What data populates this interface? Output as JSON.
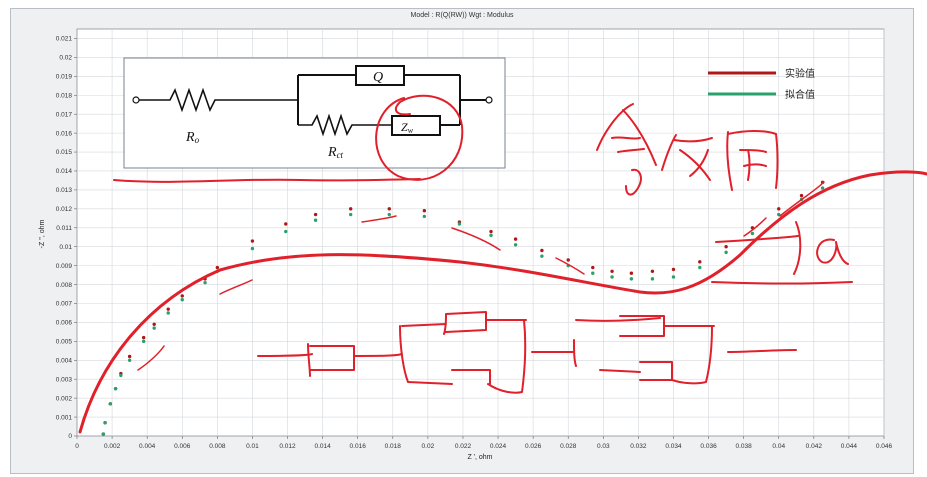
{
  "window": {
    "title": "Model : R(Q(RW))     Wgt : Modulus"
  },
  "chart_data": {
    "type": "scatter",
    "xlabel": "Z ', ohm",
    "ylabel": "-Z '', ohm",
    "xlim": [
      0,
      0.046
    ],
    "ylim": [
      0,
      0.0215
    ],
    "xticks": [
      "0",
      "0.002",
      "0.004",
      "0.006",
      "0.008",
      "0.01",
      "0.012",
      "0.014",
      "0.016",
      "0.018",
      "0.02",
      "0.022",
      "0.024",
      "0.026",
      "0.028",
      "0.03",
      "0.032",
      "0.034",
      "0.036",
      "0.038",
      "0.04",
      "0.042",
      "0.044",
      "0.046"
    ],
    "yticks": [
      "0",
      "0.001",
      "0.002",
      "0.003",
      "0.004",
      "0.005",
      "0.006",
      "0.007",
      "0.008",
      "0.009",
      "0.01",
      "0.011",
      "0.012",
      "0.013",
      "0.014",
      "0.015",
      "0.016",
      "0.017",
      "0.018",
      "0.019",
      "0.02",
      "0.021"
    ],
    "grid": true,
    "legend": "top-right",
    "series": [
      {
        "name": "实验值",
        "color": "#b01818",
        "points": [
          [
            0.0015,
            0.0001
          ],
          [
            0.0016,
            0.0007
          ],
          [
            0.0019,
            0.0017
          ],
          [
            0.0022,
            0.0025
          ],
          [
            0.0025,
            0.0033
          ],
          [
            0.003,
            0.0042
          ],
          [
            0.0038,
            0.0052
          ],
          [
            0.0044,
            0.0059
          ],
          [
            0.0052,
            0.0067
          ],
          [
            0.006,
            0.0074
          ],
          [
            0.0073,
            0.0083
          ],
          [
            0.008,
            0.0089
          ],
          [
            0.01,
            0.0103
          ],
          [
            0.0119,
            0.0112
          ],
          [
            0.0136,
            0.0117
          ],
          [
            0.0156,
            0.012
          ],
          [
            0.0178,
            0.012
          ],
          [
            0.0198,
            0.0119
          ],
          [
            0.0218,
            0.0113
          ],
          [
            0.0236,
            0.0108
          ],
          [
            0.025,
            0.0104
          ],
          [
            0.0265,
            0.0098
          ],
          [
            0.028,
            0.0093
          ],
          [
            0.0294,
            0.0089
          ],
          [
            0.0305,
            0.0087
          ],
          [
            0.0316,
            0.0086
          ],
          [
            0.0328,
            0.0087
          ],
          [
            0.034,
            0.0088
          ],
          [
            0.0355,
            0.0092
          ],
          [
            0.037,
            0.01
          ],
          [
            0.0385,
            0.011
          ],
          [
            0.04,
            0.012
          ],
          [
            0.0413,
            0.0127
          ],
          [
            0.0425,
            0.0134
          ]
        ]
      },
      {
        "name": "拟合值",
        "color": "#2aa06a",
        "points": [
          [
            0.0015,
            0.0001
          ],
          [
            0.0016,
            0.0007
          ],
          [
            0.0019,
            0.0017
          ],
          [
            0.0022,
            0.0025
          ],
          [
            0.0025,
            0.0032
          ],
          [
            0.003,
            0.004
          ],
          [
            0.0038,
            0.005
          ],
          [
            0.0044,
            0.0057
          ],
          [
            0.0052,
            0.0065
          ],
          [
            0.006,
            0.0072
          ],
          [
            0.0073,
            0.0081
          ],
          [
            0.008,
            0.0087
          ],
          [
            0.01,
            0.0099
          ],
          [
            0.0119,
            0.0108
          ],
          [
            0.0136,
            0.0114
          ],
          [
            0.0156,
            0.0117
          ],
          [
            0.0178,
            0.0117
          ],
          [
            0.0198,
            0.0116
          ],
          [
            0.0218,
            0.0112
          ],
          [
            0.0236,
            0.0106
          ],
          [
            0.025,
            0.0101
          ],
          [
            0.0265,
            0.0095
          ],
          [
            0.028,
            0.009
          ],
          [
            0.0294,
            0.0086
          ],
          [
            0.0305,
            0.0084
          ],
          [
            0.0316,
            0.0083
          ],
          [
            0.0328,
            0.0083
          ],
          [
            0.034,
            0.0084
          ],
          [
            0.0355,
            0.0089
          ],
          [
            0.037,
            0.0097
          ],
          [
            0.0385,
            0.0107
          ],
          [
            0.04,
            0.0117
          ],
          [
            0.0413,
            0.0125
          ],
          [
            0.0425,
            0.0131
          ]
        ]
      }
    ]
  },
  "circuit": {
    "r0": "R",
    "r0_sub": "o",
    "rct": "R",
    "rct_sub": "ct",
    "q": "Q",
    "zw": "Z",
    "zw_sub": "w"
  },
  "annotation": {
    "alpha": "α"
  }
}
